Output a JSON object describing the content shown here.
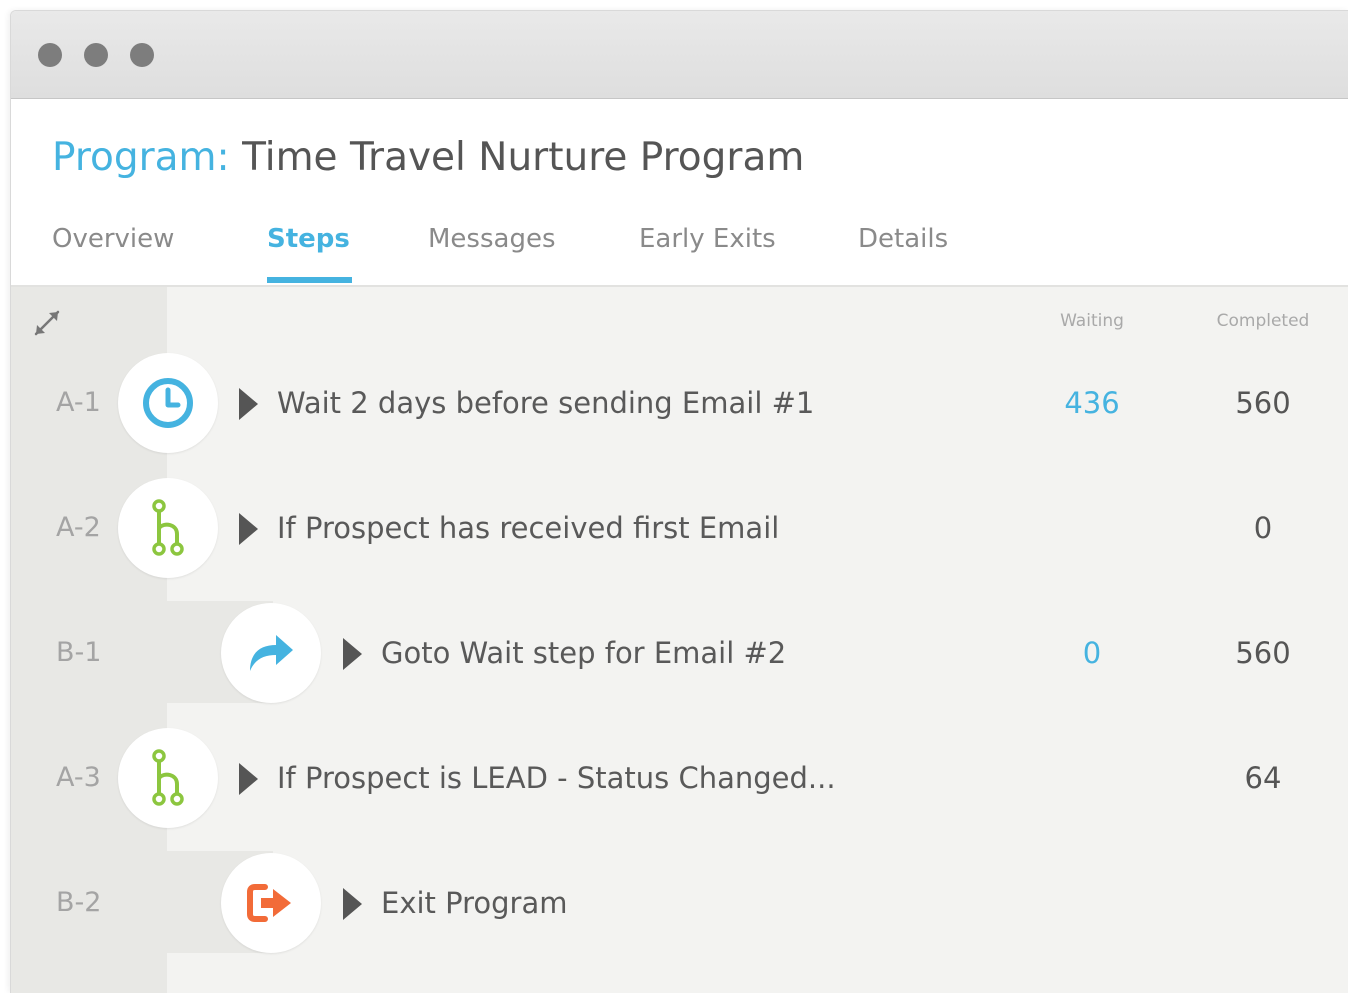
{
  "window": {
    "controls": [
      "close",
      "minimize",
      "maximize"
    ]
  },
  "program": {
    "label": "Program:",
    "name": "Time Travel Nurture Program"
  },
  "tabs": [
    {
      "label": "Overview",
      "active": false
    },
    {
      "label": "Steps",
      "active": true
    },
    {
      "label": "Messages",
      "active": false
    },
    {
      "label": "Early Exits",
      "active": false
    },
    {
      "label": "Details",
      "active": false
    }
  ],
  "columns": {
    "waiting": "Waiting",
    "completed": "Completed"
  },
  "steps": [
    {
      "id": "A-1",
      "icon": "clock-icon",
      "label": "Wait 2 days before sending Email #1",
      "waiting": "436",
      "completed": "560"
    },
    {
      "id": "A-2",
      "icon": "branch-icon",
      "label": "If Prospect has received first Email",
      "waiting": "",
      "completed": "0"
    },
    {
      "id": "B-1",
      "icon": "goto-arrow-icon",
      "label": "Goto Wait step for Email #2",
      "waiting": "0",
      "completed": "560"
    },
    {
      "id": "A-3",
      "icon": "branch-icon",
      "label": "If Prospect is LEAD - Status Changed...",
      "waiting": "",
      "completed": "64"
    },
    {
      "id": "B-2",
      "icon": "exit-icon",
      "label": "Exit Program",
      "waiting": "",
      "completed": ""
    }
  ],
  "colors": {
    "accent": "#45b3e0",
    "branch": "#8cc63f",
    "exit": "#f26b38",
    "text": "#555555"
  }
}
